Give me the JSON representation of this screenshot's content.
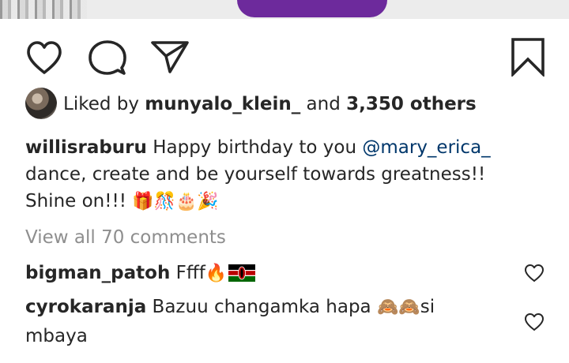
{
  "post": {
    "likes": {
      "prefix": "Liked by ",
      "user": "munyalo_klein_",
      "middle": " and ",
      "count": "3,350 others"
    },
    "caption": {
      "author": "willisraburu",
      "text_before_mention": " Happy birthday to you ",
      "mention": "@mary_erica_",
      "text_after_mention": " dance, create and be yourself towards greatness!! Shine on!!! ",
      "emojis": "🎁🎊🎂🎉"
    },
    "view_all_comments": "View all 70 comments",
    "comments": [
      {
        "user": "bigman_patoh",
        "text": " Ffff",
        "emoji": "🔥",
        "flag_icon": "kenya-flag-icon"
      },
      {
        "user": "cyrokaranja",
        "text": " Bazuu changamka hapa ",
        "emoji": "🙈🙈",
        "text_after": "si mbaya"
      }
    ]
  },
  "icons": {
    "like": "heart-outline-icon",
    "comment": "speech-bubble-icon",
    "share": "paper-plane-icon",
    "save": "bookmark-outline-icon"
  },
  "colors": {
    "text": "#262626",
    "muted": "#8e8e8e",
    "mention": "#00376b",
    "photo_accent": "#6d2a9c"
  }
}
